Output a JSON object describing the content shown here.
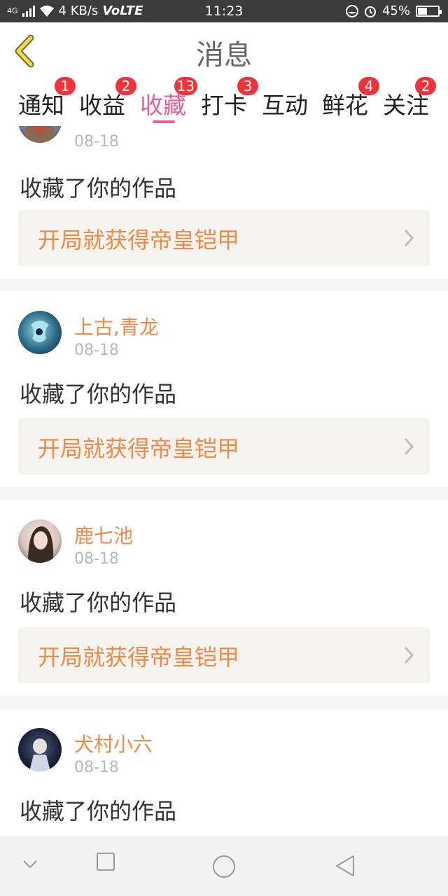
{
  "status_bar": {
    "network": "4G",
    "speed": "4 KB/s",
    "volte": "VoLTE",
    "time": "11:23",
    "battery": "45%",
    "battery_level": 0.45
  },
  "header": {
    "title": "消息"
  },
  "tabs": [
    {
      "label": "通知",
      "badge": "1"
    },
    {
      "label": "收益",
      "badge": "2"
    },
    {
      "label": "收藏",
      "badge": "13",
      "active": true
    },
    {
      "label": "打卡",
      "badge": "3"
    },
    {
      "label": "互动",
      "badge": ""
    },
    {
      "label": "鲜花",
      "badge": "4"
    },
    {
      "label": "关注",
      "badge": "2"
    }
  ],
  "feed": {
    "items": [
      {
        "user": "",
        "date": "08-18",
        "action": "收藏了你的作品",
        "work": "开局就获得帝皇铠甲"
      },
      {
        "user": "上古,青龙",
        "date": "08-18",
        "action": "收藏了你的作品",
        "work": "开局就获得帝皇铠甲"
      },
      {
        "user": "鹿七池",
        "date": "08-18",
        "action": "收藏了你的作品",
        "work": "开局就获得帝皇铠甲"
      },
      {
        "user": "犬村小六",
        "date": "08-18",
        "action": "收藏了你的作品",
        "work": ""
      }
    ]
  },
  "colors": {
    "accent": "#e85e9a",
    "username": "#f08a4b",
    "badge": "#f2333a",
    "back_arrow": "#f5d94a"
  },
  "nav": {
    "icons": [
      "chevron-down-icon",
      "square-icon",
      "circle-icon",
      "triangle-back-icon"
    ]
  }
}
